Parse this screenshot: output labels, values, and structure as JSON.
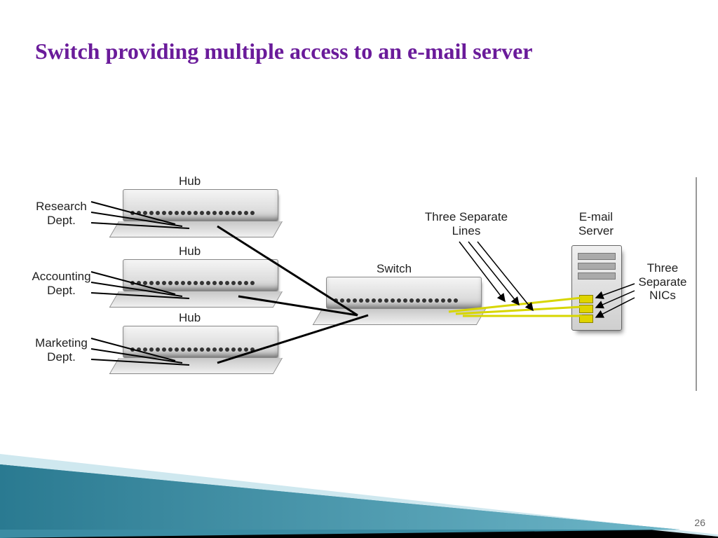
{
  "title": "Switch providing multiple access to an e-mail server",
  "labels": {
    "research": "Research\nDept.",
    "accounting": "Accounting\nDept.",
    "marketing": "Marketing\nDept.",
    "hub": "Hub",
    "switch": "Switch",
    "threeLines": "Three Separate\nLines",
    "emailServer": "E-mail\nServer",
    "threeNics": "Three\nSeparate\nNICs"
  },
  "pageNumber": "26"
}
